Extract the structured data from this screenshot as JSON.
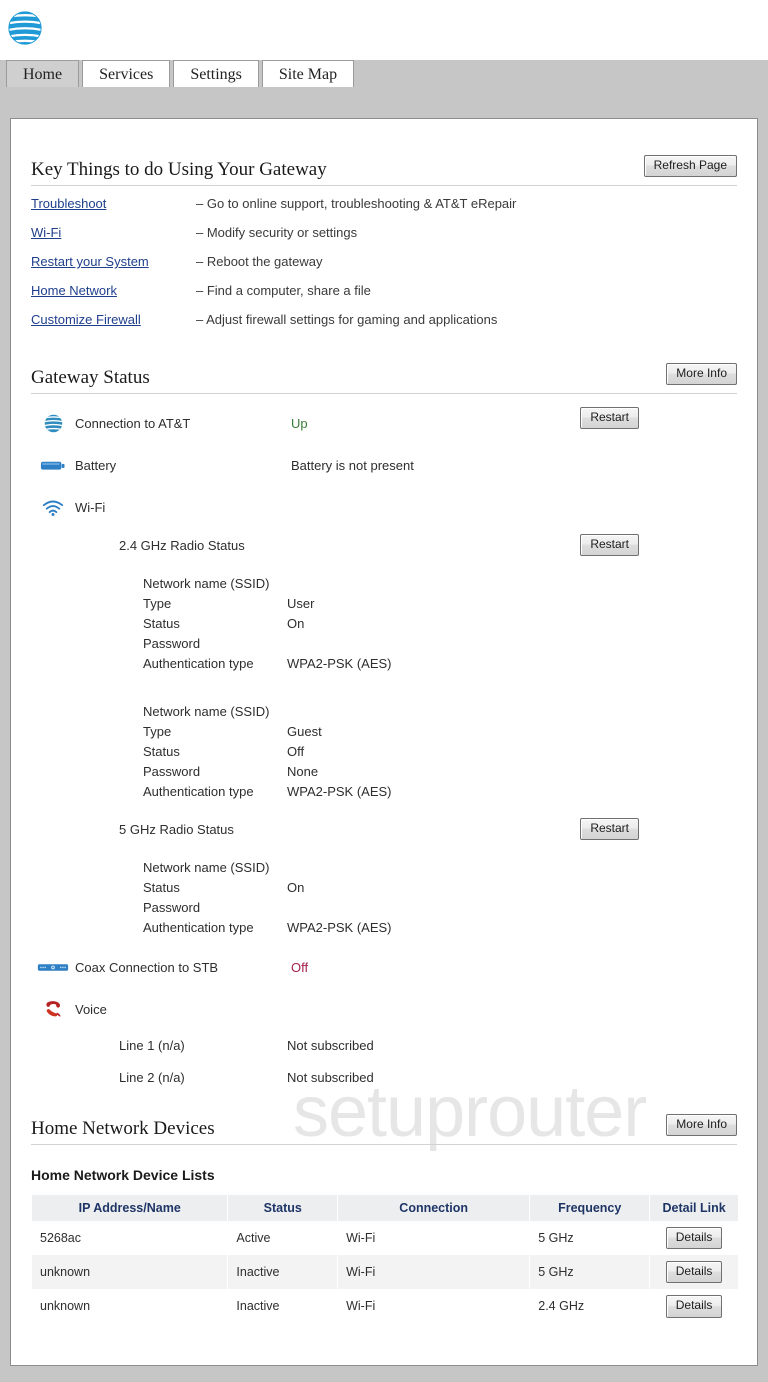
{
  "brand": {
    "logo_icon": "att-globe-icon",
    "logo_color": "#1f9ad6"
  },
  "tabs": [
    {
      "label": "Home",
      "active": true
    },
    {
      "label": "Services",
      "active": false
    },
    {
      "label": "Settings",
      "active": false
    },
    {
      "label": "Site Map",
      "active": false
    }
  ],
  "watermark": "setuprouter",
  "key_things": {
    "title": "Key Things to do Using Your Gateway",
    "refresh_label": "Refresh Page",
    "rows": [
      {
        "link": "Troubleshoot",
        "desc": "– Go to online support, troubleshooting & AT&T eRepair"
      },
      {
        "link": "Wi-Fi",
        "desc": "– Modify security or settings"
      },
      {
        "link": "Restart your System",
        "desc": "– Reboot the gateway"
      },
      {
        "link": "Home Network",
        "desc": "– Find a computer, share a file"
      },
      {
        "link": "Customize Firewall",
        "desc": "– Adjust firewall settings for gaming and applications"
      }
    ]
  },
  "gateway_status": {
    "title": "Gateway Status",
    "more_info_label": "More Info",
    "restart_label": "Restart",
    "connection": {
      "label": "Connection to AT&T",
      "value": "Up",
      "icon": "att-globe-icon"
    },
    "battery": {
      "label": "Battery",
      "value": "Battery is not present",
      "icon": "battery-icon"
    },
    "wifi": {
      "label": "Wi-Fi",
      "icon": "wifi-icon"
    },
    "radio_24": {
      "heading": "2.4 GHz Radio Status",
      "networks": [
        {
          "ssid_label": "Network name (SSID)",
          "ssid_value": "",
          "type_label": "Type",
          "type_value": "User",
          "status_label": "Status",
          "status_value": "On",
          "status_state": "on",
          "password_label": "Password",
          "password_value": "",
          "auth_label": "Authentication type",
          "auth_value": "WPA2-PSK (AES)"
        },
        {
          "ssid_label": "Network name (SSID)",
          "ssid_value": "",
          "type_label": "Type",
          "type_value": "Guest",
          "status_label": "Status",
          "status_value": "Off",
          "status_state": "off",
          "password_label": "Password",
          "password_value": "None",
          "auth_label": "Authentication type",
          "auth_value": "WPA2-PSK (AES)"
        }
      ]
    },
    "radio_5": {
      "heading": "5 GHz Radio Status",
      "ssid_label": "Network name (SSID)",
      "ssid_value": "",
      "status_label": "Status",
      "status_value": "On",
      "password_label": "Password",
      "password_value": "",
      "auth_label": "Authentication type",
      "auth_value": "WPA2-PSK (AES)"
    },
    "coax": {
      "label": "Coax Connection to STB",
      "value": "Off",
      "icon": "set-top-box-icon"
    },
    "voice": {
      "label": "Voice",
      "icon": "telephone-icon",
      "lines": [
        {
          "label": "Line 1 (n/a)",
          "value": "Not subscribed"
        },
        {
          "label": "Line 2 (n/a)",
          "value": "Not subscribed"
        }
      ]
    }
  },
  "home_network": {
    "title": "Home Network Devices",
    "more_info_label": "More Info",
    "subtitle": "Home Network Device Lists",
    "columns": [
      "IP Address/Name",
      "Status",
      "Connection",
      "Frequency",
      "Detail Link"
    ],
    "details_label": "Details",
    "rows": [
      {
        "name": "5268ac",
        "status": "Active",
        "connection": "Wi-Fi",
        "frequency": "5 GHz",
        "detail": "Details"
      },
      {
        "name": "unknown",
        "status": "Inactive",
        "connection": "Wi-Fi",
        "frequency": "5 GHz",
        "detail": "Details"
      },
      {
        "name": "unknown",
        "status": "Inactive",
        "connection": "Wi-Fi",
        "frequency": "2.4 GHz",
        "detail": "Details"
      }
    ]
  }
}
